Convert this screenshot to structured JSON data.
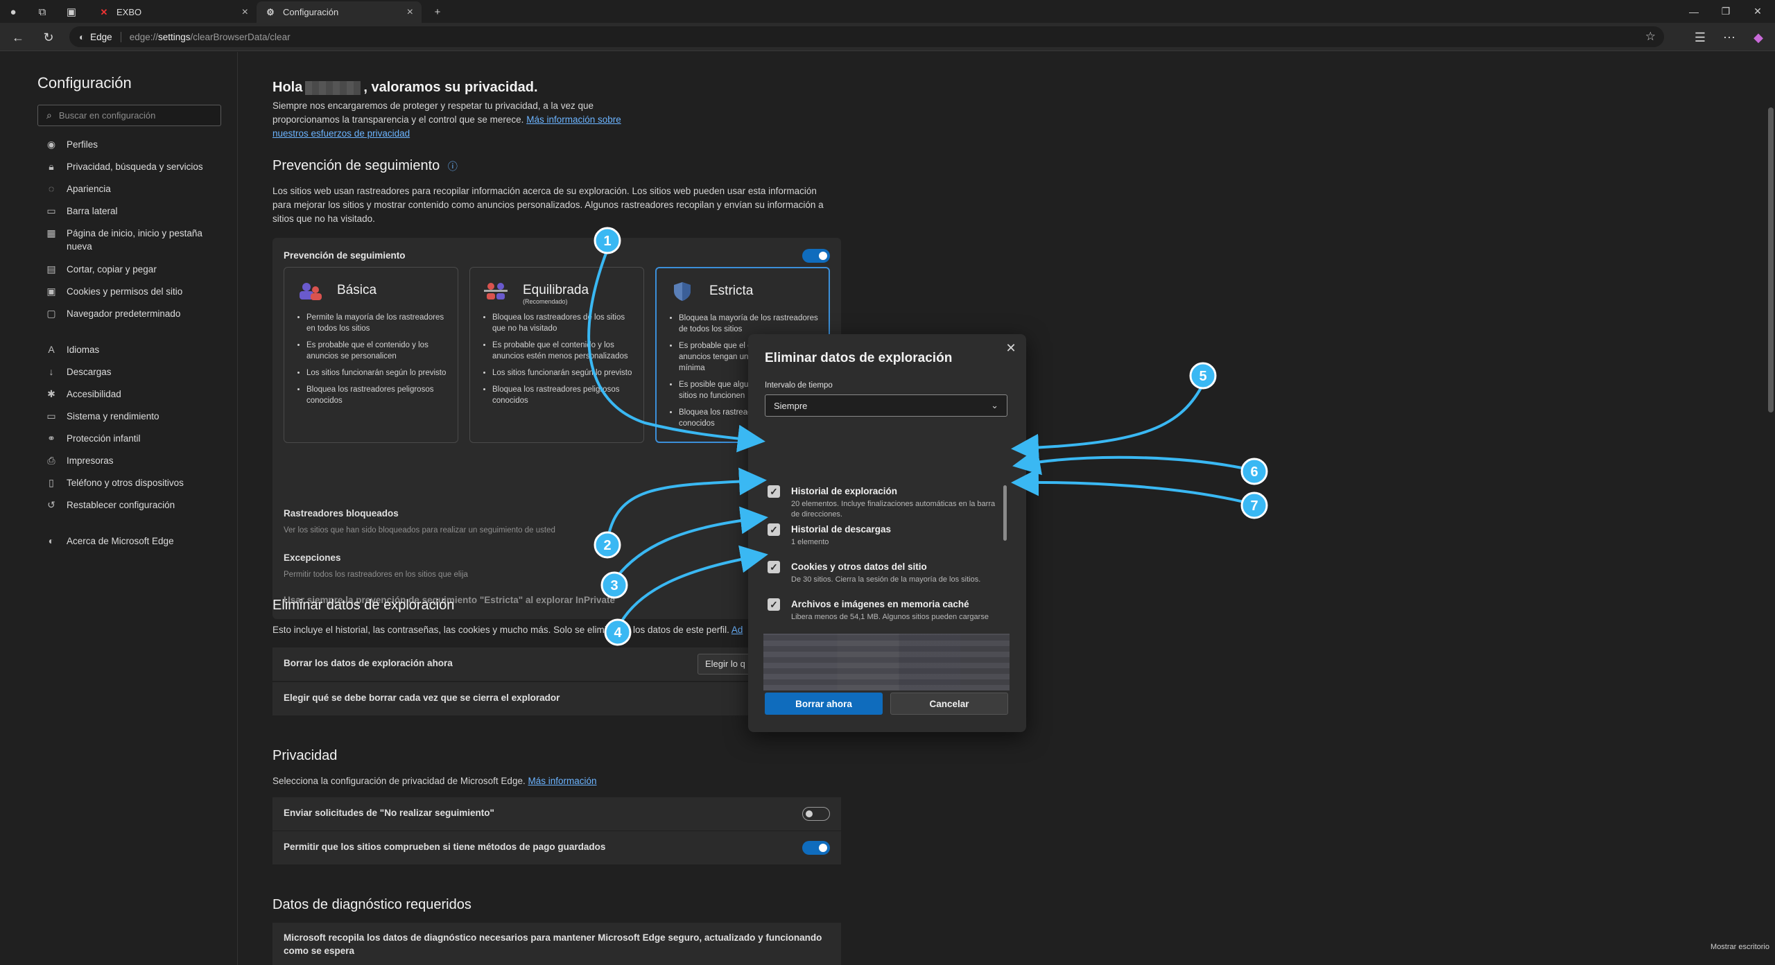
{
  "tabs": [
    {
      "label": "EXBO",
      "icon": "x-logo-icon"
    },
    {
      "label": "Configuración",
      "icon": "gear-icon"
    }
  ],
  "address": {
    "chip": "Edge",
    "scheme": "edge://",
    "host": "settings",
    "path": "/clearBrowserData/clear"
  },
  "sidebar": {
    "title": "Configuración",
    "search_placeholder": "Buscar en configuración",
    "items": [
      {
        "label": "Perfiles",
        "icon": "profile-icon"
      },
      {
        "label": "Privacidad, búsqueda y servicios",
        "icon": "lock-icon"
      },
      {
        "label": "Apariencia",
        "icon": "palette-icon"
      },
      {
        "label": "Barra lateral",
        "icon": "sidebar-icon"
      },
      {
        "label": "Página de inicio, inicio y pestaña nueva",
        "icon": "home-icon"
      },
      {
        "label": "Cortar, copiar y pegar",
        "icon": "clipboard-icon"
      },
      {
        "label": "Cookies y permisos del sitio",
        "icon": "cookie-icon"
      },
      {
        "label": "Navegador predeterminado",
        "icon": "browser-icon"
      },
      {
        "label": "Idiomas",
        "icon": "language-icon"
      },
      {
        "label": "Descargas",
        "icon": "download-icon"
      },
      {
        "label": "Accesibilidad",
        "icon": "accessibility-icon"
      },
      {
        "label": "Sistema y rendimiento",
        "icon": "system-icon"
      },
      {
        "label": "Protección infantil",
        "icon": "family-icon"
      },
      {
        "label": "Impresoras",
        "icon": "printer-icon"
      },
      {
        "label": "Teléfono y otros dispositivos",
        "icon": "phone-icon"
      },
      {
        "label": "Restablecer configuración",
        "icon": "reset-icon"
      },
      {
        "label": "Acerca de Microsoft Edge",
        "icon": "edge-icon"
      }
    ]
  },
  "main": {
    "hello_before": "Hola",
    "hello_after": ", valoramos su privacidad.",
    "intro_line1": "Siempre nos encargaremos de proteger y respetar tu privacidad, a la vez que",
    "intro_line2": "proporcionamos la transparencia y el control que se merece.",
    "intro_link1": "Más información sobre",
    "intro_link2": "nuestros esfuerzos de privacidad",
    "tracking_title": "Prevención de seguimiento",
    "tracking_desc1": "Los sitios web usan rastreadores para recopilar información acerca de su exploración. Los sitios web pueden usar esta información",
    "tracking_desc2": "para mejorar los sitios y mostrar contenido como anuncios personalizados. Algunos rastreadores recopilan y envían su información a",
    "tracking_desc3": "sitios que no ha visitado.",
    "tracking_card_label": "Prevención de seguimiento",
    "modes": [
      {
        "title": "Básica",
        "sub": "",
        "bullets": [
          "Permite la mayoría de los rastreadores en todos los sitios",
          "Es probable que el contenido y los anuncios se personalicen",
          "Los sitios funcionarán según lo previsto",
          "Bloquea los rastreadores peligrosos conocidos"
        ]
      },
      {
        "title": "Equilibrada",
        "sub": "(Recomendado)",
        "bullets": [
          "Bloquea los rastreadores de los sitios que no ha visitado",
          "Es probable que el contenido y los anuncios estén menos personalizados",
          "Los sitios funcionarán según lo previsto",
          "Bloquea los rastreadores peligrosos conocidos"
        ]
      },
      {
        "title": "Estricta",
        "sub": "",
        "bullets": [
          "Bloquea la mayoría de los rastreadores de todos los sitios",
          "Es probable que el contenido y los anuncios tengan una personalización mínima",
          "Es posible que algunas partes de los sitios no funcionen",
          "Bloquea los rastreadores peligrosos conocidos"
        ]
      }
    ],
    "blocked_label": "Rastreadores bloqueados",
    "blocked_desc": "Ver los sitios que han sido bloqueados para realizar un seguimiento de usted",
    "exceptions_label": "Excepciones",
    "exceptions_desc": "Permitir todos los rastreadores en los sitios que elija",
    "strict_inprivate": "Usar siempre la prevención de seguimiento \"Estricta\" al explorar InPrivate",
    "clear_title": "Eliminar datos de exploración",
    "clear_desc": "Esto incluye el historial, las contraseñas, las cookies y mucho más. Solo se eliminarán los datos de este perfil.",
    "clear_desc_link": "Ad",
    "clear_now": "Borrar los datos de exploración ahora",
    "clear_choose_btn": "Elegir lo q",
    "clear_on_close": "Elegir qué se debe borrar cada vez que se cierra el explorador",
    "privacy_title": "Privacidad",
    "privacy_desc": "Selecciona la configuración de privacidad de Microsoft Edge.",
    "privacy_link": "Más información",
    "dnt_label": "Enviar solicitudes de \"No realizar seguimiento\"",
    "payment_label": "Permitir que los sitios comprueben si tiene métodos de pago guardados",
    "diag_title": "Datos de diagnóstico requeridos",
    "diag_desc1": "Microsoft recopila los datos de diagnóstico necesarios para mantener Microsoft Edge seguro, actualizado y funcionando",
    "diag_desc2": "como se espera"
  },
  "modal": {
    "title": "Eliminar datos de exploración",
    "range_label": "Intervalo de tiempo",
    "range_value": "Siempre",
    "items": [
      {
        "title": "Historial de exploración",
        "desc": "20 elementos. Incluye finalizaciones automáticas en la barra de direcciones.",
        "checked": true
      },
      {
        "title": "Historial de descargas",
        "desc": "1 elemento",
        "checked": true
      },
      {
        "title": "Cookies y otros datos del sitio",
        "desc": "De 30 sitios. Cierra la sesión de la mayoría de los sitios.",
        "checked": true
      },
      {
        "title": "Archivos e imágenes en memoria caché",
        "desc": "Libera menos de 54,1 MB. Algunos sitios pueden cargarse",
        "checked": true
      }
    ],
    "clear_btn": "Borrar ahora",
    "cancel_btn": "Cancelar"
  },
  "annotations": [
    "1",
    "2",
    "3",
    "4",
    "5",
    "6",
    "7"
  ],
  "annotation_color": "#3ab8f3",
  "taskbar": {
    "show_desktop": "Mostrar escritorio"
  }
}
